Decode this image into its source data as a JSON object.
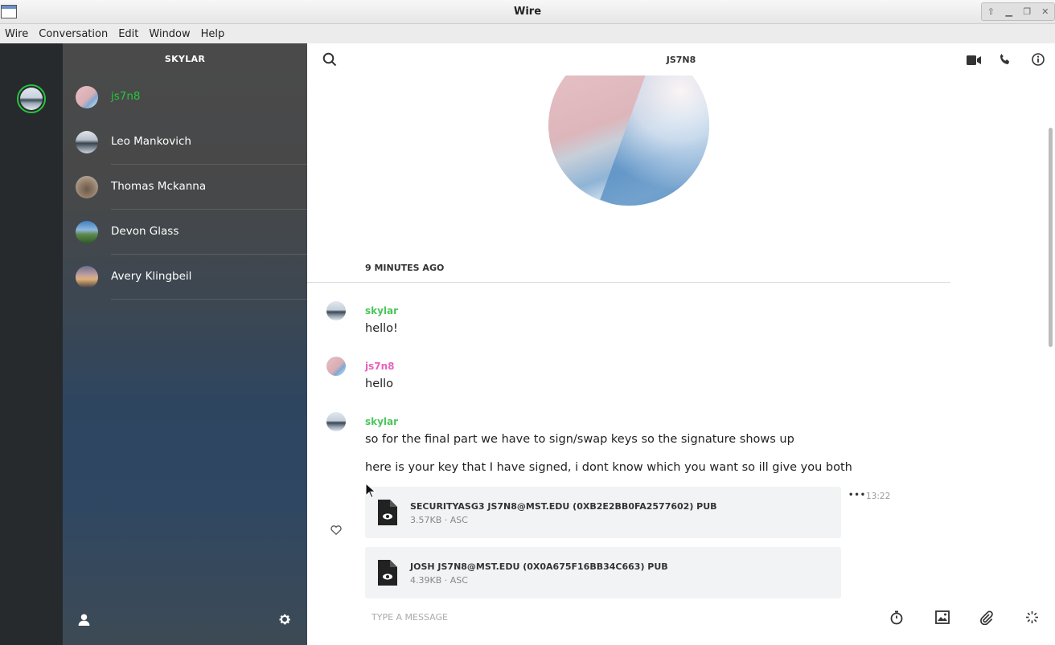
{
  "window": {
    "title": "Wire"
  },
  "menu": [
    "Wire",
    "Conversation",
    "Edit",
    "Window",
    "Help"
  ],
  "sidebar": {
    "user": "SKYLAR",
    "conversations": [
      {
        "name": "js7n8",
        "active": true
      },
      {
        "name": "Leo Mankovich"
      },
      {
        "name": "Thomas Mckanna"
      },
      {
        "name": "Devon Glass"
      },
      {
        "name": "Avery Klingbeil"
      }
    ]
  },
  "conversation": {
    "title": "JS7N8",
    "day_marker": "9 MINUTES AGO",
    "messages": [
      {
        "sender": "skylar",
        "text": "hello!"
      },
      {
        "sender": "js7n8",
        "text": "hello"
      },
      {
        "sender": "skylar",
        "text": "so for the final part we have to sign/swap keys so the signature shows up"
      },
      {
        "text": "here is your key that I have signed, i dont know which you want so ill give you both"
      }
    ],
    "files": [
      {
        "name": "SECURITYASG3 JS7N8@MST.EDU (0XB2E2BB0FA2577602) PUB",
        "meta": "3.57KB · ASC",
        "time": "13:22"
      },
      {
        "name": "JOSH JS7N8@MST.EDU (0X0A675F16BB34C663) PUB",
        "meta": "4.39KB · ASC"
      }
    ],
    "input_placeholder": "TYPE A MESSAGE",
    "more_label": "•••"
  },
  "colors": {
    "accent_green": "#27c53b",
    "js7n8_pink": "#e85fbf",
    "skylar_green": "#4bc45c"
  }
}
